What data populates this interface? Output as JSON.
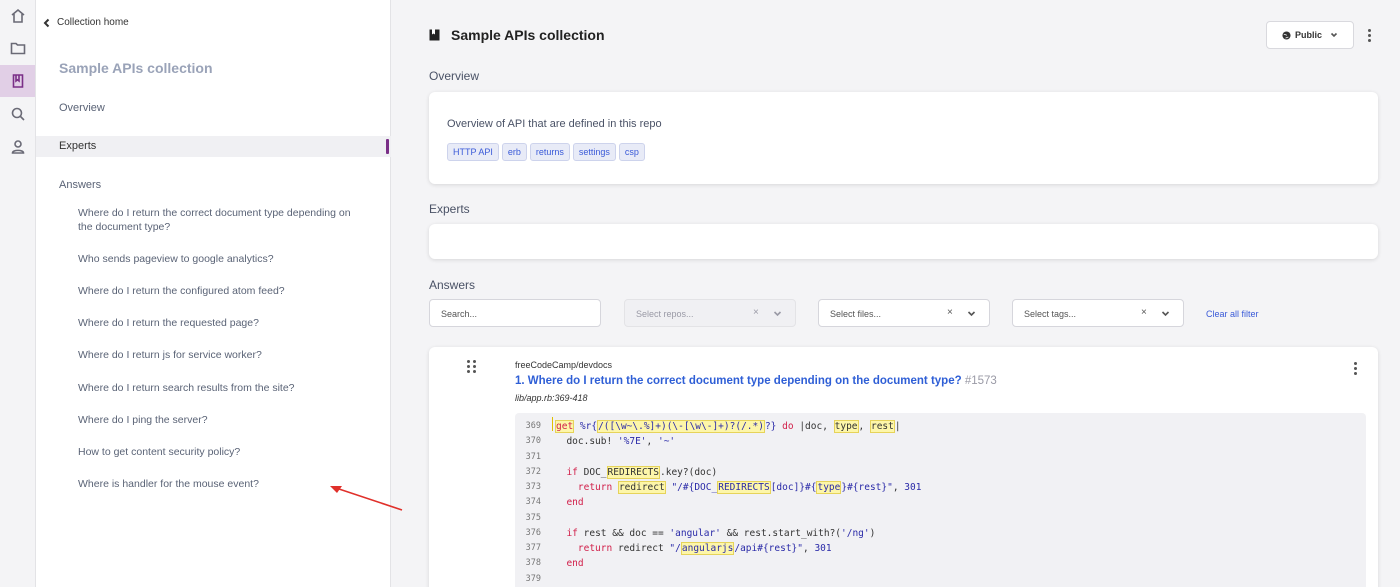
{
  "rail": {
    "icons": [
      "home-icon",
      "folder-icon",
      "book-icon",
      "search-icon",
      "user-icon"
    ],
    "active": "book-icon"
  },
  "sidebar": {
    "back_label": "Collection home",
    "title": "Sample APIs collection",
    "overview": "Overview",
    "experts": "Experts",
    "answers": "Answers",
    "questions": [
      "Where do I return the correct document type depending on the document type?",
      "Who sends pageview to google analytics?",
      "Where do I return the configured atom feed?",
      "Where do I return the requested page?",
      "Where do I return js for service worker?",
      "Where do I return search results from the site?",
      "Where do I ping the server?",
      "How to get content security policy?",
      "Where is handler for the mouse event?"
    ]
  },
  "header": {
    "title": "Sample APIs collection",
    "visibility": "Public"
  },
  "overview": {
    "label": "Overview",
    "text": "Overview of API that are defined in this repo",
    "tags": [
      "HTTP API",
      "erb",
      "returns",
      "settings",
      "csp"
    ]
  },
  "experts": {
    "label": "Experts"
  },
  "answers": {
    "label": "Answers",
    "search_placeholder": "Search...",
    "repos_placeholder": "Select repos...",
    "files_placeholder": "Select files...",
    "tags_placeholder": "Select tags...",
    "clear_all": "Clear all filter",
    "item": {
      "repo": "freeCodeCamp/devdocs",
      "title": "1. Where do I return the correct document type depending on the document type?",
      "number": "#1573",
      "path": "lib/app.rb:369-418",
      "line_numbers": [
        "369",
        "370",
        "371",
        "372",
        "373",
        "374",
        "375",
        "376",
        "377",
        "378",
        "379"
      ]
    }
  },
  "colors": {
    "accent": "#7a2f87",
    "link": "#2f5fd6",
    "tag_bg": "#e8ebf7",
    "highlight": "#fdf6a9"
  }
}
